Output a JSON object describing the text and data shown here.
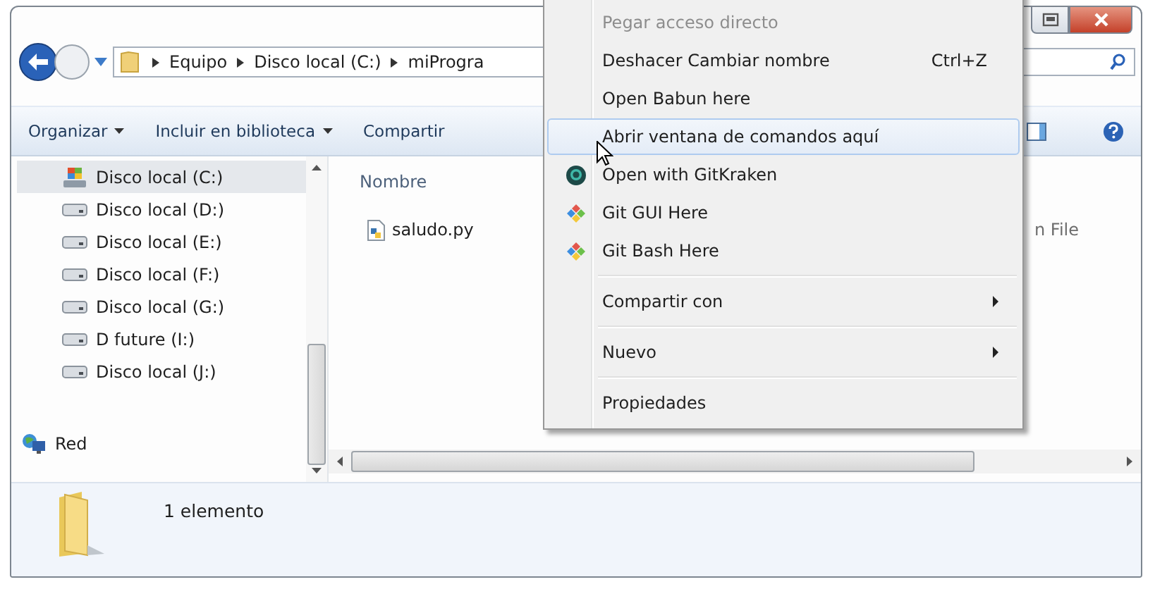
{
  "address_bar": {
    "segments": [
      "Equipo",
      "Disco local (C:)",
      "miProgra"
    ]
  },
  "toolbar": {
    "items": [
      {
        "label": "Organizar",
        "dropdown": true
      },
      {
        "label": "Incluir en biblioteca",
        "dropdown": true
      },
      {
        "label": "Compartir",
        "dropdown": false
      }
    ]
  },
  "sidebar": {
    "items": [
      {
        "label": "Disco local (C:)",
        "kind": "system-drive",
        "selected": true
      },
      {
        "label": "Disco local (D:)",
        "kind": "drive",
        "selected": false
      },
      {
        "label": "Disco local (E:)",
        "kind": "drive",
        "selected": false
      },
      {
        "label": "Disco local (F:)",
        "kind": "drive",
        "selected": false
      },
      {
        "label": "Disco local (G:)",
        "kind": "drive",
        "selected": false
      },
      {
        "label": "D future (I:)",
        "kind": "drive",
        "selected": false
      },
      {
        "label": "Disco local (J:)",
        "kind": "drive",
        "selected": false
      },
      {
        "label": "Red",
        "kind": "network",
        "selected": false
      }
    ]
  },
  "file_list": {
    "columns": [
      "Nombre"
    ],
    "files": [
      {
        "name": "saludo.py",
        "type": "n File"
      }
    ]
  },
  "status_bar": {
    "count": "1 elemento"
  },
  "context_menu": {
    "items": [
      {
        "kind": "plain",
        "label": "Pegar acceso directo",
        "disabled": true,
        "selected": false
      },
      {
        "kind": "plain",
        "label": "Deshacer Cambiar nombre",
        "shortcut": "Ctrl+Z",
        "disabled": false,
        "selected": false
      },
      {
        "kind": "plain",
        "label": "Open Babun here",
        "disabled": false,
        "selected": false
      },
      {
        "kind": "plain",
        "label": "Abrir ventana de comandos aquí",
        "disabled": false,
        "selected": true
      },
      {
        "kind": "ring",
        "label": "Open with GitKraken",
        "disabled": false,
        "selected": false
      },
      {
        "kind": "diamond",
        "label": "Git GUI Here",
        "disabled": false,
        "selected": false
      },
      {
        "kind": "diamond",
        "label": "Git Bash Here",
        "disabled": false,
        "selected": false
      },
      {
        "kind": "separator"
      },
      {
        "kind": "submenu",
        "label": "Compartir con",
        "disabled": false,
        "selected": false
      },
      {
        "kind": "separator"
      },
      {
        "kind": "submenu",
        "label": "Nuevo",
        "disabled": false,
        "selected": false
      },
      {
        "kind": "separator"
      },
      {
        "kind": "plain",
        "label": "Propiedades",
        "disabled": false,
        "selected": false
      }
    ]
  }
}
